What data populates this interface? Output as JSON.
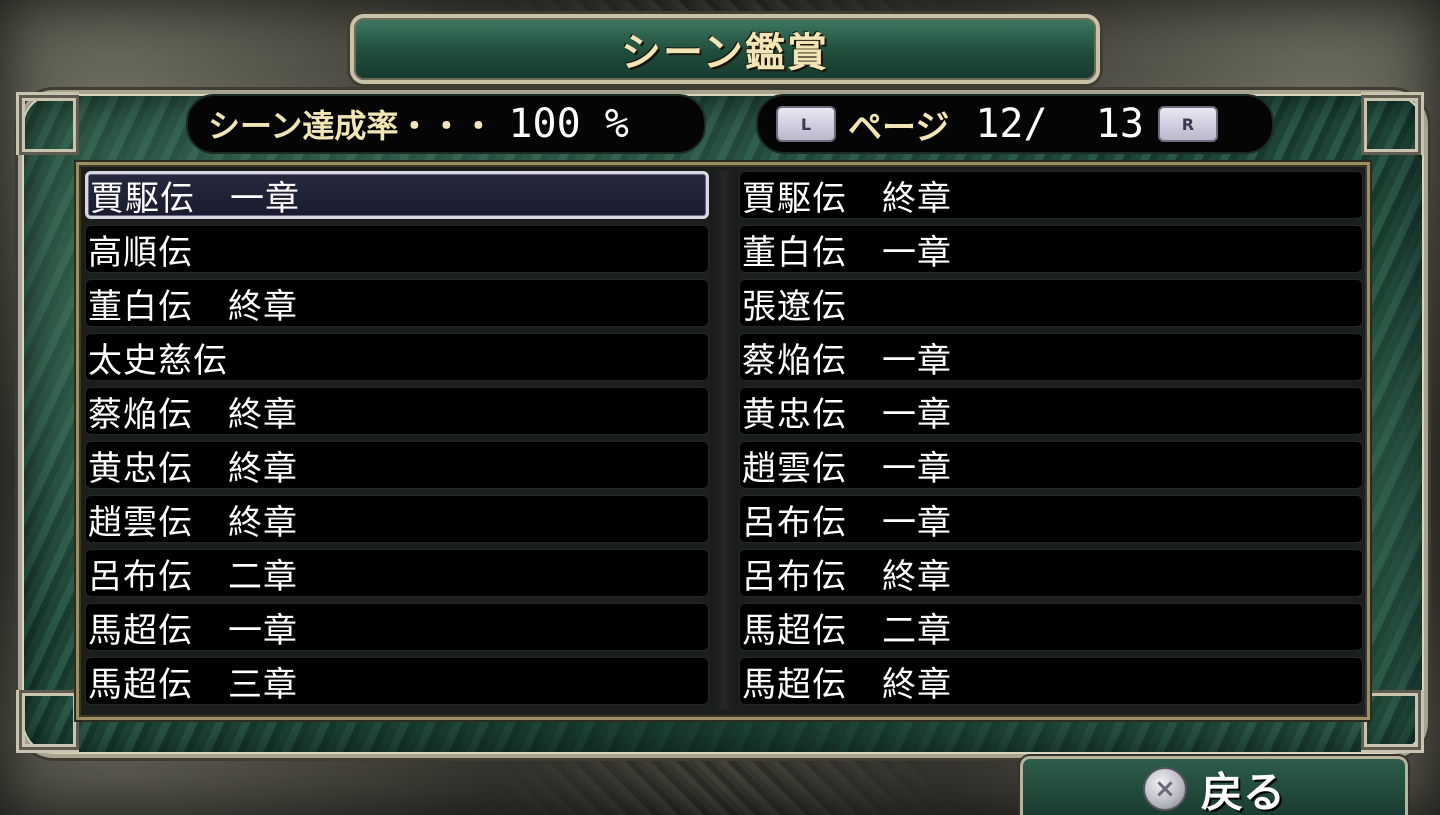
{
  "header": {
    "title": "シーン鑑賞"
  },
  "stats": {
    "rate_label": "シーン達成率・・・",
    "rate_value": "100 %"
  },
  "pager": {
    "l_button": "L",
    "label": "ページ",
    "value": "12/  13",
    "r_button": "R"
  },
  "scenes": {
    "left": [
      {
        "label": "賈駆伝　一章"
      },
      {
        "label": "高順伝"
      },
      {
        "label": "董白伝　終章"
      },
      {
        "label": "太史慈伝"
      },
      {
        "label": "蔡焔伝　終章"
      },
      {
        "label": "黄忠伝　終章"
      },
      {
        "label": "趙雲伝　終章"
      },
      {
        "label": "呂布伝　二章"
      },
      {
        "label": "馬超伝　一章"
      },
      {
        "label": "馬超伝　三章"
      }
    ],
    "right": [
      {
        "label": "賈駆伝　終章"
      },
      {
        "label": "董白伝　一章"
      },
      {
        "label": "張遼伝"
      },
      {
        "label": "蔡焔伝　一章"
      },
      {
        "label": "黄忠伝　一章"
      },
      {
        "label": "趙雲伝　一章"
      },
      {
        "label": "呂布伝　一章"
      },
      {
        "label": "呂布伝　終章"
      },
      {
        "label": "馬超伝　二章"
      },
      {
        "label": "馬超伝　終章"
      }
    ]
  },
  "footer": {
    "back_icon": "cross-button-icon",
    "back_label": "戻る"
  },
  "colors": {
    "title_text": "#f1e5b6",
    "panel_green": "#1f4537",
    "selection_border": "#d8d8e4"
  }
}
